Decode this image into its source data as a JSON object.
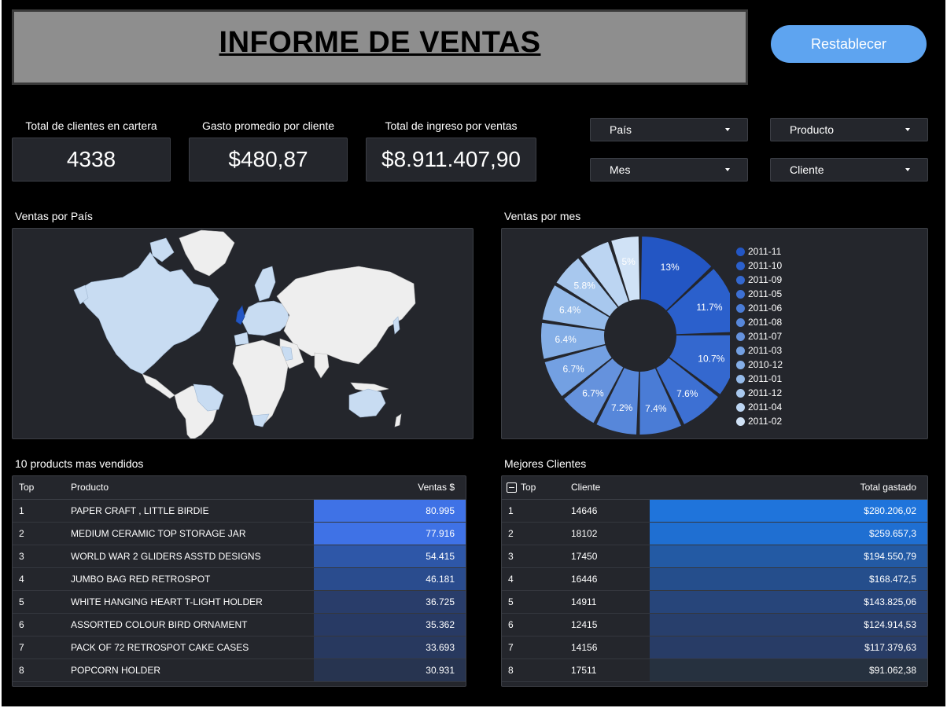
{
  "header": {
    "title": "INFORME DE VENTAS",
    "reset_label": "Restablecer"
  },
  "kpis": [
    {
      "label": "Total de clientes en cartera",
      "value": "4338"
    },
    {
      "label": "Gasto promedio por cliente",
      "value": "$480,87"
    },
    {
      "label": "Total de ingreso por ventas",
      "value": "$8.911.407,90"
    }
  ],
  "filters": {
    "country": "País",
    "product": "Producto",
    "month": "Mes",
    "customer": "Cliente"
  },
  "map": {
    "label": "Ventas por País"
  },
  "pie": {
    "label": "Ventas por mes",
    "colors": [
      "#2356c4",
      "#2b60cc",
      "#3468cf",
      "#3d70d3",
      "#4a7cd6",
      "#5787da",
      "#6592dd",
      "#73a0e2",
      "#84aee6",
      "#95bbea",
      "#a8c8ee",
      "#bcd5f2",
      "#d0e2f6"
    ]
  },
  "chart_data": {
    "type": "pie",
    "title": "Ventas por mes",
    "categories": [
      "2011-11",
      "2011-10",
      "2011-09",
      "2011-05",
      "2011-06",
      "2011-08",
      "2011-07",
      "2011-03",
      "2010-12",
      "2011-01",
      "2011-12",
      "2011-04",
      "2011-02"
    ],
    "values": [
      13,
      11.7,
      10.7,
      7.6,
      7.4,
      7.2,
      6.7,
      6.7,
      6.4,
      6.4,
      5.8,
      5.5,
      5
    ],
    "labels": [
      "13%",
      "11.7%",
      "10.7%",
      "7.6%",
      "7.4%",
      "7.2%",
      "6.7%",
      "6.7%",
      "6.4%",
      "6.4%",
      "5.8%",
      "",
      "5%"
    ],
    "legend": "right"
  },
  "products": {
    "label": "10 products mas vendidos",
    "headers": {
      "top": "Top",
      "product": "Producto",
      "sales": "Ventas $"
    },
    "rows": [
      {
        "top": "1",
        "product": "PAPER CRAFT , LITTLE BIRDIE",
        "sales": "80.995",
        "color": "#3f72e6"
      },
      {
        "top": "2",
        "product": "MEDIUM CERAMIC TOP STORAGE JAR",
        "sales": "77.916",
        "color": "#3f72e6"
      },
      {
        "top": "3",
        "product": "WORLD WAR 2 GLIDERS ASSTD DESIGNS",
        "sales": "54.415",
        "color": "#2e57a8"
      },
      {
        "top": "4",
        "product": "JUMBO BAG RED RETROSPOT",
        "sales": "46.181",
        "color": "#2a4c8e"
      },
      {
        "top": "5",
        "product": "WHITE HANGING HEART T-LIGHT HOLDER",
        "sales": "36.725",
        "color": "#293d6a"
      },
      {
        "top": "6",
        "product": "ASSORTED COLOUR BIRD ORNAMENT",
        "sales": "35.362",
        "color": "#283a64"
      },
      {
        "top": "7",
        "product": "PACK OF 72 RETROSPOT CAKE CASES",
        "sales": "33.693",
        "color": "#28395f"
      },
      {
        "top": "8",
        "product": "POPCORN HOLDER",
        "sales": "30.931",
        "color": "#273450"
      }
    ]
  },
  "customers": {
    "label": "Mejores Clientes",
    "headers": {
      "top": "Top",
      "customer": "Cliente",
      "total": "Total gastado"
    },
    "rows": [
      {
        "top": "1",
        "customer": "14646",
        "total": "$280.206,02",
        "color": "#1f74db"
      },
      {
        "top": "2",
        "customer": "18102",
        "total": "$259.657,3",
        "color": "#1f6fd2"
      },
      {
        "top": "3",
        "customer": "17450",
        "total": "$194.550,79",
        "color": "#235aa4"
      },
      {
        "top": "4",
        "customer": "16446",
        "total": "$168.472,5",
        "color": "#254e8c"
      },
      {
        "top": "5",
        "customer": "14911",
        "total": "$143.825,06",
        "color": "#27457a"
      },
      {
        "top": "6",
        "customer": "12415",
        "total": "$124.914,53",
        "color": "#283f6c"
      },
      {
        "top": "7",
        "customer": "14156",
        "total": "$117.379,63",
        "color": "#283c66"
      },
      {
        "top": "8",
        "customer": "17511",
        "total": "$91.062,38",
        "color": "#26313f"
      }
    ]
  }
}
